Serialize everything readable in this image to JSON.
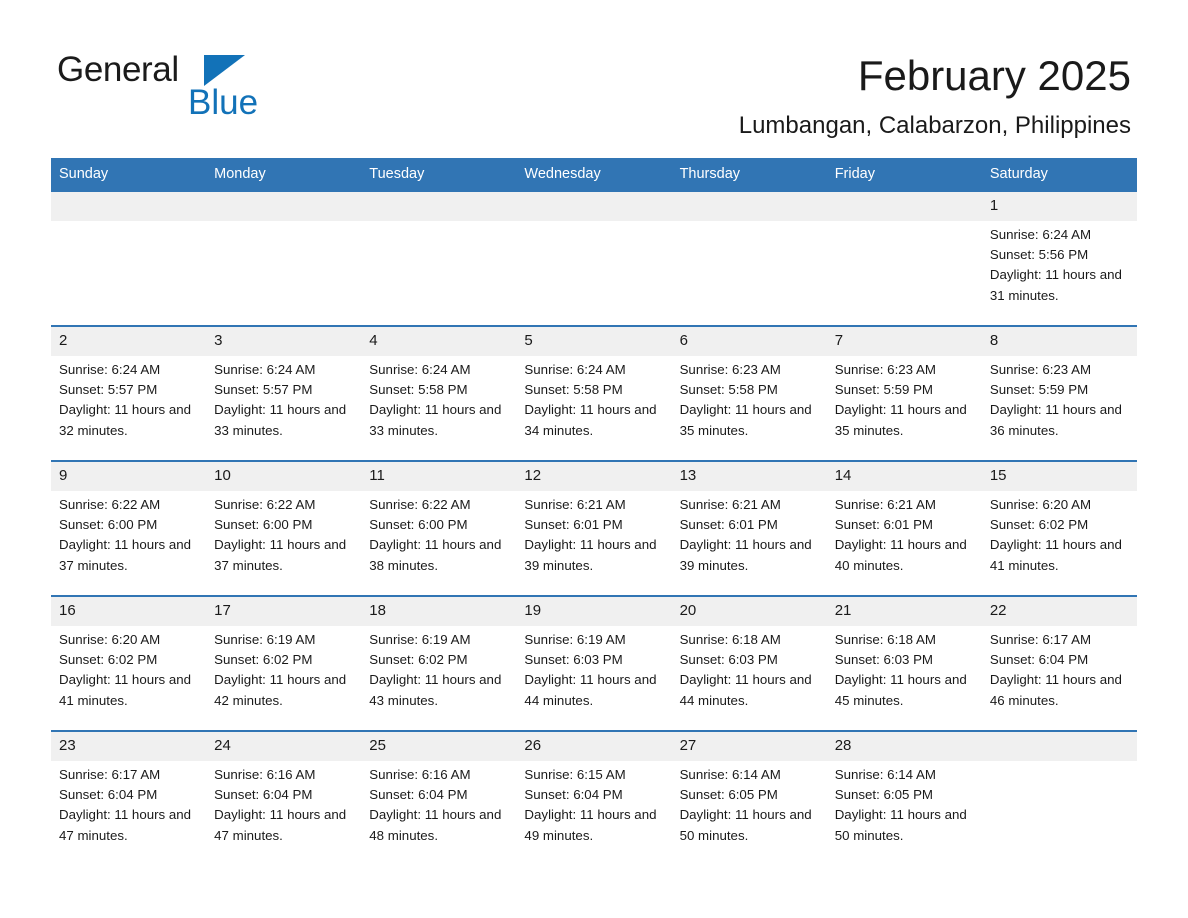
{
  "brand": {
    "name_part1": "General",
    "name_part2": "Blue",
    "accent_color": "#1272b8"
  },
  "header": {
    "title": "February 2025",
    "subtitle": "Lumbangan, Calabarzon, Philippines"
  },
  "calendar": {
    "header_bg": "#3175b4",
    "daynum_bg": "#f0f0f0",
    "weekday_headers": [
      "Sunday",
      "Monday",
      "Tuesday",
      "Wednesday",
      "Thursday",
      "Friday",
      "Saturday"
    ],
    "weeks": [
      [
        {
          "day": "",
          "sunrise": "",
          "sunset": "",
          "daylight": ""
        },
        {
          "day": "",
          "sunrise": "",
          "sunset": "",
          "daylight": ""
        },
        {
          "day": "",
          "sunrise": "",
          "sunset": "",
          "daylight": ""
        },
        {
          "day": "",
          "sunrise": "",
          "sunset": "",
          "daylight": ""
        },
        {
          "day": "",
          "sunrise": "",
          "sunset": "",
          "daylight": ""
        },
        {
          "day": "",
          "sunrise": "",
          "sunset": "",
          "daylight": ""
        },
        {
          "day": "1",
          "sunrise": "Sunrise: 6:24 AM",
          "sunset": "Sunset: 5:56 PM",
          "daylight": "Daylight: 11 hours and 31 minutes."
        }
      ],
      [
        {
          "day": "2",
          "sunrise": "Sunrise: 6:24 AM",
          "sunset": "Sunset: 5:57 PM",
          "daylight": "Daylight: 11 hours and 32 minutes."
        },
        {
          "day": "3",
          "sunrise": "Sunrise: 6:24 AM",
          "sunset": "Sunset: 5:57 PM",
          "daylight": "Daylight: 11 hours and 33 minutes."
        },
        {
          "day": "4",
          "sunrise": "Sunrise: 6:24 AM",
          "sunset": "Sunset: 5:58 PM",
          "daylight": "Daylight: 11 hours and 33 minutes."
        },
        {
          "day": "5",
          "sunrise": "Sunrise: 6:24 AM",
          "sunset": "Sunset: 5:58 PM",
          "daylight": "Daylight: 11 hours and 34 minutes."
        },
        {
          "day": "6",
          "sunrise": "Sunrise: 6:23 AM",
          "sunset": "Sunset: 5:58 PM",
          "daylight": "Daylight: 11 hours and 35 minutes."
        },
        {
          "day": "7",
          "sunrise": "Sunrise: 6:23 AM",
          "sunset": "Sunset: 5:59 PM",
          "daylight": "Daylight: 11 hours and 35 minutes."
        },
        {
          "day": "8",
          "sunrise": "Sunrise: 6:23 AM",
          "sunset": "Sunset: 5:59 PM",
          "daylight": "Daylight: 11 hours and 36 minutes."
        }
      ],
      [
        {
          "day": "9",
          "sunrise": "Sunrise: 6:22 AM",
          "sunset": "Sunset: 6:00 PM",
          "daylight": "Daylight: 11 hours and 37 minutes."
        },
        {
          "day": "10",
          "sunrise": "Sunrise: 6:22 AM",
          "sunset": "Sunset: 6:00 PM",
          "daylight": "Daylight: 11 hours and 37 minutes."
        },
        {
          "day": "11",
          "sunrise": "Sunrise: 6:22 AM",
          "sunset": "Sunset: 6:00 PM",
          "daylight": "Daylight: 11 hours and 38 minutes."
        },
        {
          "day": "12",
          "sunrise": "Sunrise: 6:21 AM",
          "sunset": "Sunset: 6:01 PM",
          "daylight": "Daylight: 11 hours and 39 minutes."
        },
        {
          "day": "13",
          "sunrise": "Sunrise: 6:21 AM",
          "sunset": "Sunset: 6:01 PM",
          "daylight": "Daylight: 11 hours and 39 minutes."
        },
        {
          "day": "14",
          "sunrise": "Sunrise: 6:21 AM",
          "sunset": "Sunset: 6:01 PM",
          "daylight": "Daylight: 11 hours and 40 minutes."
        },
        {
          "day": "15",
          "sunrise": "Sunrise: 6:20 AM",
          "sunset": "Sunset: 6:02 PM",
          "daylight": "Daylight: 11 hours and 41 minutes."
        }
      ],
      [
        {
          "day": "16",
          "sunrise": "Sunrise: 6:20 AM",
          "sunset": "Sunset: 6:02 PM",
          "daylight": "Daylight: 11 hours and 41 minutes."
        },
        {
          "day": "17",
          "sunrise": "Sunrise: 6:19 AM",
          "sunset": "Sunset: 6:02 PM",
          "daylight": "Daylight: 11 hours and 42 minutes."
        },
        {
          "day": "18",
          "sunrise": "Sunrise: 6:19 AM",
          "sunset": "Sunset: 6:02 PM",
          "daylight": "Daylight: 11 hours and 43 minutes."
        },
        {
          "day": "19",
          "sunrise": "Sunrise: 6:19 AM",
          "sunset": "Sunset: 6:03 PM",
          "daylight": "Daylight: 11 hours and 44 minutes."
        },
        {
          "day": "20",
          "sunrise": "Sunrise: 6:18 AM",
          "sunset": "Sunset: 6:03 PM",
          "daylight": "Daylight: 11 hours and 44 minutes."
        },
        {
          "day": "21",
          "sunrise": "Sunrise: 6:18 AM",
          "sunset": "Sunset: 6:03 PM",
          "daylight": "Daylight: 11 hours and 45 minutes."
        },
        {
          "day": "22",
          "sunrise": "Sunrise: 6:17 AM",
          "sunset": "Sunset: 6:04 PM",
          "daylight": "Daylight: 11 hours and 46 minutes."
        }
      ],
      [
        {
          "day": "23",
          "sunrise": "Sunrise: 6:17 AM",
          "sunset": "Sunset: 6:04 PM",
          "daylight": "Daylight: 11 hours and 47 minutes."
        },
        {
          "day": "24",
          "sunrise": "Sunrise: 6:16 AM",
          "sunset": "Sunset: 6:04 PM",
          "daylight": "Daylight: 11 hours and 47 minutes."
        },
        {
          "day": "25",
          "sunrise": "Sunrise: 6:16 AM",
          "sunset": "Sunset: 6:04 PM",
          "daylight": "Daylight: 11 hours and 48 minutes."
        },
        {
          "day": "26",
          "sunrise": "Sunrise: 6:15 AM",
          "sunset": "Sunset: 6:04 PM",
          "daylight": "Daylight: 11 hours and 49 minutes."
        },
        {
          "day": "27",
          "sunrise": "Sunrise: 6:14 AM",
          "sunset": "Sunset: 6:05 PM",
          "daylight": "Daylight: 11 hours and 50 minutes."
        },
        {
          "day": "28",
          "sunrise": "Sunrise: 6:14 AM",
          "sunset": "Sunset: 6:05 PM",
          "daylight": "Daylight: 11 hours and 50 minutes."
        },
        {
          "day": "",
          "sunrise": "",
          "sunset": "",
          "daylight": ""
        }
      ]
    ]
  }
}
